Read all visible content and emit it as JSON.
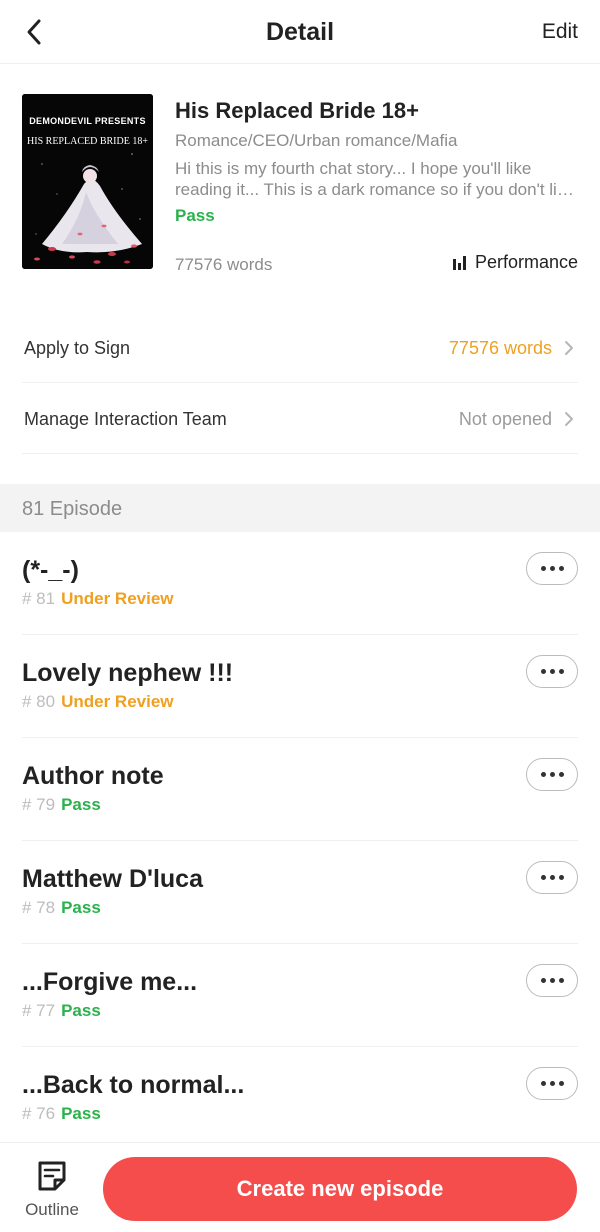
{
  "header": {
    "title": "Detail",
    "edit_label": "Edit"
  },
  "book": {
    "cover": {
      "author_text": "DEMONDEVIL PRESENTS",
      "title_text": "HIS REPLACED BRIDE 18+"
    },
    "title": "His Replaced Bride 18+",
    "genres": "Romance/CEO/Urban romance/Mafia",
    "description": "Hi this is my fourth chat story... I hope you'll like reading it... This is a dark romance so if you don't like such content please skip",
    "status": "Pass",
    "word_count": "77576 words",
    "performance_label": "Performance"
  },
  "settings": [
    {
      "label": "Apply to Sign",
      "value": "77576 words",
      "value_color": "#f0a020"
    },
    {
      "label": "Manage Interaction Team",
      "value": "Not opened",
      "value_color": "#9a9a9a"
    }
  ],
  "episodes_section": {
    "title": "81 Episode"
  },
  "episodes": [
    {
      "title": "(*-_-)",
      "number": "# 81",
      "status": "Under Review",
      "status_color": "#f0a020"
    },
    {
      "title": "Lovely nephew !!!",
      "number": "# 80",
      "status": "Under Review",
      "status_color": "#f0a020"
    },
    {
      "title": "Author note",
      "number": "# 79",
      "status": "Pass",
      "status_color": "#2bb24c"
    },
    {
      "title": "Matthew D'luca",
      "number": "# 78",
      "status": "Pass",
      "status_color": "#2bb24c"
    },
    {
      "title": "...Forgive me...",
      "number": "# 77",
      "status": "Pass",
      "status_color": "#2bb24c"
    },
    {
      "title": "...Back to normal...",
      "number": "# 76",
      "status": "Pass",
      "status_color": "#2bb24c"
    }
  ],
  "bottom_bar": {
    "outline_label": "Outline",
    "create_label": "Create new episode",
    "create_color": "#f54c4c"
  },
  "icons": {
    "back": "chevron-left-icon",
    "performance": "bar-chart-icon",
    "row_chevron": "chevron-right-icon",
    "episode_more": "more-dots-icon",
    "outline": "outline-note-icon"
  }
}
